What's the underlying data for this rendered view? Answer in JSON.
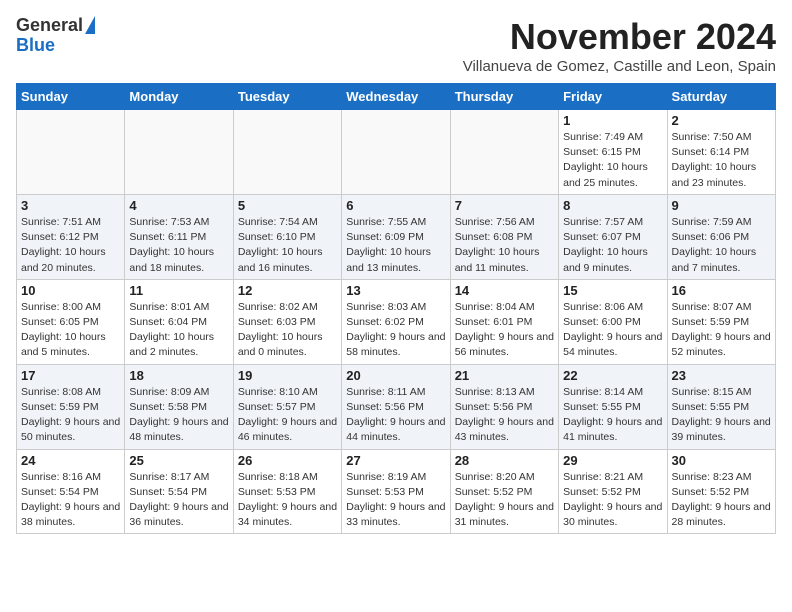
{
  "header": {
    "logo_line1": "General",
    "logo_line2": "Blue",
    "month_title": "November 2024",
    "subtitle": "Villanueva de Gomez, Castille and Leon, Spain"
  },
  "weekdays": [
    "Sunday",
    "Monday",
    "Tuesday",
    "Wednesday",
    "Thursday",
    "Friday",
    "Saturday"
  ],
  "weeks": [
    [
      {
        "day": "",
        "info": ""
      },
      {
        "day": "",
        "info": ""
      },
      {
        "day": "",
        "info": ""
      },
      {
        "day": "",
        "info": ""
      },
      {
        "day": "",
        "info": ""
      },
      {
        "day": "1",
        "info": "Sunrise: 7:49 AM\nSunset: 6:15 PM\nDaylight: 10 hours and 25 minutes."
      },
      {
        "day": "2",
        "info": "Sunrise: 7:50 AM\nSunset: 6:14 PM\nDaylight: 10 hours and 23 minutes."
      }
    ],
    [
      {
        "day": "3",
        "info": "Sunrise: 7:51 AM\nSunset: 6:12 PM\nDaylight: 10 hours and 20 minutes."
      },
      {
        "day": "4",
        "info": "Sunrise: 7:53 AM\nSunset: 6:11 PM\nDaylight: 10 hours and 18 minutes."
      },
      {
        "day": "5",
        "info": "Sunrise: 7:54 AM\nSunset: 6:10 PM\nDaylight: 10 hours and 16 minutes."
      },
      {
        "day": "6",
        "info": "Sunrise: 7:55 AM\nSunset: 6:09 PM\nDaylight: 10 hours and 13 minutes."
      },
      {
        "day": "7",
        "info": "Sunrise: 7:56 AM\nSunset: 6:08 PM\nDaylight: 10 hours and 11 minutes."
      },
      {
        "day": "8",
        "info": "Sunrise: 7:57 AM\nSunset: 6:07 PM\nDaylight: 10 hours and 9 minutes."
      },
      {
        "day": "9",
        "info": "Sunrise: 7:59 AM\nSunset: 6:06 PM\nDaylight: 10 hours and 7 minutes."
      }
    ],
    [
      {
        "day": "10",
        "info": "Sunrise: 8:00 AM\nSunset: 6:05 PM\nDaylight: 10 hours and 5 minutes."
      },
      {
        "day": "11",
        "info": "Sunrise: 8:01 AM\nSunset: 6:04 PM\nDaylight: 10 hours and 2 minutes."
      },
      {
        "day": "12",
        "info": "Sunrise: 8:02 AM\nSunset: 6:03 PM\nDaylight: 10 hours and 0 minutes."
      },
      {
        "day": "13",
        "info": "Sunrise: 8:03 AM\nSunset: 6:02 PM\nDaylight: 9 hours and 58 minutes."
      },
      {
        "day": "14",
        "info": "Sunrise: 8:04 AM\nSunset: 6:01 PM\nDaylight: 9 hours and 56 minutes."
      },
      {
        "day": "15",
        "info": "Sunrise: 8:06 AM\nSunset: 6:00 PM\nDaylight: 9 hours and 54 minutes."
      },
      {
        "day": "16",
        "info": "Sunrise: 8:07 AM\nSunset: 5:59 PM\nDaylight: 9 hours and 52 minutes."
      }
    ],
    [
      {
        "day": "17",
        "info": "Sunrise: 8:08 AM\nSunset: 5:59 PM\nDaylight: 9 hours and 50 minutes."
      },
      {
        "day": "18",
        "info": "Sunrise: 8:09 AM\nSunset: 5:58 PM\nDaylight: 9 hours and 48 minutes."
      },
      {
        "day": "19",
        "info": "Sunrise: 8:10 AM\nSunset: 5:57 PM\nDaylight: 9 hours and 46 minutes."
      },
      {
        "day": "20",
        "info": "Sunrise: 8:11 AM\nSunset: 5:56 PM\nDaylight: 9 hours and 44 minutes."
      },
      {
        "day": "21",
        "info": "Sunrise: 8:13 AM\nSunset: 5:56 PM\nDaylight: 9 hours and 43 minutes."
      },
      {
        "day": "22",
        "info": "Sunrise: 8:14 AM\nSunset: 5:55 PM\nDaylight: 9 hours and 41 minutes."
      },
      {
        "day": "23",
        "info": "Sunrise: 8:15 AM\nSunset: 5:55 PM\nDaylight: 9 hours and 39 minutes."
      }
    ],
    [
      {
        "day": "24",
        "info": "Sunrise: 8:16 AM\nSunset: 5:54 PM\nDaylight: 9 hours and 38 minutes."
      },
      {
        "day": "25",
        "info": "Sunrise: 8:17 AM\nSunset: 5:54 PM\nDaylight: 9 hours and 36 minutes."
      },
      {
        "day": "26",
        "info": "Sunrise: 8:18 AM\nSunset: 5:53 PM\nDaylight: 9 hours and 34 minutes."
      },
      {
        "day": "27",
        "info": "Sunrise: 8:19 AM\nSunset: 5:53 PM\nDaylight: 9 hours and 33 minutes."
      },
      {
        "day": "28",
        "info": "Sunrise: 8:20 AM\nSunset: 5:52 PM\nDaylight: 9 hours and 31 minutes."
      },
      {
        "day": "29",
        "info": "Sunrise: 8:21 AM\nSunset: 5:52 PM\nDaylight: 9 hours and 30 minutes."
      },
      {
        "day": "30",
        "info": "Sunrise: 8:23 AM\nSunset: 5:52 PM\nDaylight: 9 hours and 28 minutes."
      }
    ]
  ]
}
